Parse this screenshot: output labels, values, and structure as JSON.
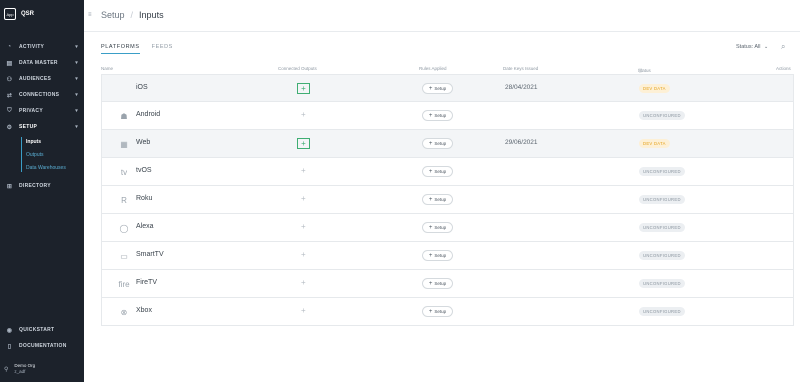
{
  "brand": {
    "logo": "App",
    "name": "QSR"
  },
  "sidebar": {
    "items": [
      {
        "label": "ACTIVITY",
        "icon": "gauge-icon"
      },
      {
        "label": "DATA MASTER",
        "icon": "database-icon"
      },
      {
        "label": "AUDIENCES",
        "icon": "users-icon"
      },
      {
        "label": "CONNECTIONS",
        "icon": "plug-icon"
      },
      {
        "label": "PRIVACY",
        "icon": "shield-icon"
      },
      {
        "label": "SETUP",
        "icon": "gear-icon"
      }
    ],
    "sub_items": [
      "Inputs",
      "Outputs",
      "Data Warehouses"
    ],
    "directory": "DIRECTORY",
    "quickstart": "QUICKSTART",
    "documentation": "DOCUMENTATION",
    "user": {
      "org": "Demo Org",
      "name": "z_adf"
    }
  },
  "breadcrumb": {
    "parent": "Setup",
    "separator": "/",
    "current": "Inputs"
  },
  "tabs": [
    "PLATFORMS",
    "FEEDS"
  ],
  "filter": {
    "label": "Status: All"
  },
  "table": {
    "columns": [
      "Name",
      "Connected Outputs",
      "Rules Applied",
      "Date Keys Issued",
      "Status",
      "Actions"
    ],
    "setup_label": "Setup",
    "rows": [
      {
        "name": "iOS",
        "icon": "apple-icon",
        "glyph": "",
        "connected": true,
        "date": "28/04/2021",
        "status": "DEV DATA",
        "status_kind": "dev"
      },
      {
        "name": "Android",
        "icon": "android-icon",
        "glyph": "☗",
        "connected": false,
        "date": "",
        "status": "UNCONFIGURED",
        "status_kind": "unc"
      },
      {
        "name": "Web",
        "icon": "web-icon",
        "glyph": "▦",
        "connected": true,
        "date": "29/06/2021",
        "status": "DEV DATA",
        "status_kind": "dev"
      },
      {
        "name": "tvOS",
        "icon": "appletv-icon",
        "glyph": "tv",
        "connected": false,
        "date": "",
        "status": "UNCONFIGURED",
        "status_kind": "unc"
      },
      {
        "name": "Roku",
        "icon": "roku-icon",
        "glyph": "R",
        "connected": false,
        "date": "",
        "status": "UNCONFIGURED",
        "status_kind": "unc"
      },
      {
        "name": "Alexa",
        "icon": "alexa-icon",
        "glyph": "◯",
        "connected": false,
        "date": "",
        "status": "UNCONFIGURED",
        "status_kind": "unc"
      },
      {
        "name": "SmartTV",
        "icon": "tv-icon",
        "glyph": "▭",
        "connected": false,
        "date": "",
        "status": "UNCONFIGURED",
        "status_kind": "unc"
      },
      {
        "name": "FireTV",
        "icon": "firetv-icon",
        "glyph": "fire",
        "connected": false,
        "date": "",
        "status": "UNCONFIGURED",
        "status_kind": "unc"
      },
      {
        "name": "Xbox",
        "icon": "xbox-icon",
        "glyph": "⊗",
        "connected": false,
        "date": "",
        "status": "UNCONFIGURED",
        "status_kind": "unc"
      }
    ]
  }
}
